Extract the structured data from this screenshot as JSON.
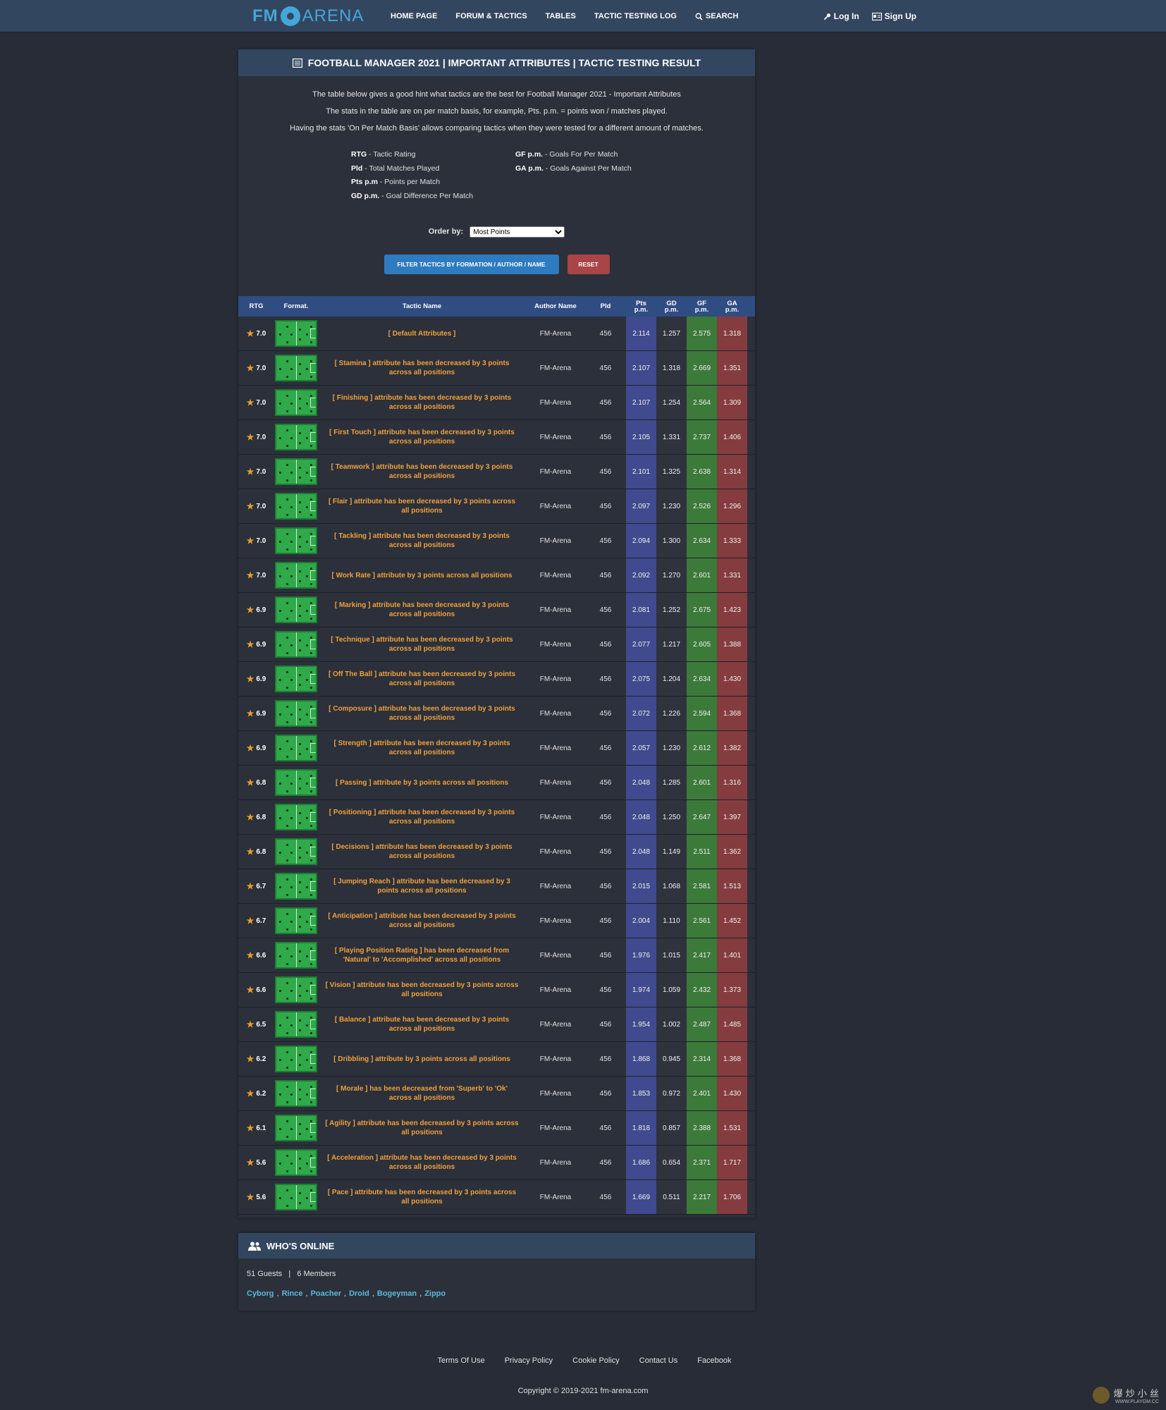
{
  "nav": {
    "logo_left": "FM",
    "logo_right": "ARENA",
    "links": [
      "HOME PAGE",
      "FORUM & TACTICS",
      "TABLES",
      "TACTIC TESTING LOG",
      "SEARCH"
    ],
    "login": "Log In",
    "signup": "Sign Up"
  },
  "card": {
    "title": "FOOTBALL MANAGER 2021 | IMPORTANT ATTRIBUTES | TACTIC TESTING RESULT",
    "intro": [
      "The table below gives a good hint what tactics are the best for Football Manager 2021 - Important Attributes",
      "The stats in the table are on per match basis, for example, Pts. p.m. = points won / matches played.",
      "Having the stats 'On Per Match Basis' allows comparing tactics when they were tested for a different amount of matches."
    ],
    "legend": {
      "rtg_k": "RTG",
      "rtg_v": " - Tactic Rating",
      "gf_k": "GF p.m.",
      "gf_v": " - Goals For Per Match",
      "pld_k": "Pld",
      "pld_v": " - Total Matches Played",
      "ga_k": "GA p.m.",
      "ga_v": " - Goals Against Per Match",
      "pts_k": "Pts p.m",
      "pts_v": " - Points per Match",
      "gd_k": "GD p.m.",
      "gd_v": " - Goal Difference Per Match"
    },
    "order_label": "Order by:",
    "order_value": "Most Points",
    "filter_button": "FILTER TACTICS BY FORMATION / AUTHOR / NAME",
    "reset_button": "RESET"
  },
  "table": {
    "headers": {
      "rtg": "RTG",
      "format": "Format.",
      "name": "Tactic Name",
      "author": "Author Name",
      "pld": "Pld",
      "pts_1": "Pts",
      "pts_2": "p.m.",
      "gd_1": "GD",
      "gd_2": "p.m.",
      "gf_1": "GF",
      "gf_2": "p.m.",
      "ga_1": "GA",
      "ga_2": "p.m."
    },
    "rows": [
      {
        "rtg": "7.0",
        "name": "[ Default Attributes ]",
        "author": "FM-Arena",
        "pld": "456",
        "pts": "2.114",
        "gd": "1.257",
        "gf": "2.575",
        "ga": "1.318"
      },
      {
        "rtg": "7.0",
        "name": "[ Stamina ] attribute has been decreased by 3 points across all positions",
        "author": "FM-Arena",
        "pld": "456",
        "pts": "2.107",
        "gd": "1.318",
        "gf": "2.669",
        "ga": "1.351"
      },
      {
        "rtg": "7.0",
        "name": "[ Finishing ] attribute has been decreased by 3 points across all positions",
        "author": "FM-Arena",
        "pld": "456",
        "pts": "2.107",
        "gd": "1.254",
        "gf": "2.564",
        "ga": "1.309"
      },
      {
        "rtg": "7.0",
        "name": "[ First Touch ] attribute has been decreased by 3 points across all positions",
        "author": "FM-Arena",
        "pld": "456",
        "pts": "2.105",
        "gd": "1.331",
        "gf": "2.737",
        "ga": "1.406"
      },
      {
        "rtg": "7.0",
        "name": "[ Teamwork ] attribute has been decreased by 3 points across all positions",
        "author": "FM-Arena",
        "pld": "456",
        "pts": "2.101",
        "gd": "1.325",
        "gf": "2.638",
        "ga": "1.314"
      },
      {
        "rtg": "7.0",
        "name": "[ Flair ] attribute has been decreased by 3 points across all positions",
        "author": "FM-Arena",
        "pld": "456",
        "pts": "2.097",
        "gd": "1.230",
        "gf": "2.526",
        "ga": "1.296"
      },
      {
        "rtg": "7.0",
        "name": "[ Tackling ] attribute has been decreased by 3 points across all positions",
        "author": "FM-Arena",
        "pld": "456",
        "pts": "2.094",
        "gd": "1.300",
        "gf": "2.634",
        "ga": "1.333"
      },
      {
        "rtg": "7.0",
        "name": "[ Work Rate ] attribute by 3 points across all positions",
        "author": "FM-Arena",
        "pld": "456",
        "pts": "2.092",
        "gd": "1.270",
        "gf": "2.601",
        "ga": "1.331"
      },
      {
        "rtg": "6.9",
        "name": "[ Marking ] attribute has been decreased by 3 points across all positions",
        "author": "FM-Arena",
        "pld": "456",
        "pts": "2.081",
        "gd": "1.252",
        "gf": "2.675",
        "ga": "1.423"
      },
      {
        "rtg": "6.9",
        "name": "[ Technique ] attribute has been decreased by 3 points across all positions",
        "author": "FM-Arena",
        "pld": "456",
        "pts": "2.077",
        "gd": "1.217",
        "gf": "2.605",
        "ga": "1.388"
      },
      {
        "rtg": "6.9",
        "name": "[ Off The Ball ] attribute has been decreased by 3 points across all positions",
        "author": "FM-Arena",
        "pld": "456",
        "pts": "2.075",
        "gd": "1.204",
        "gf": "2.634",
        "ga": "1.430"
      },
      {
        "rtg": "6.9",
        "name": "[ Composure ] attribute has been decreased by 3 points across all positions",
        "author": "FM-Arena",
        "pld": "456",
        "pts": "2.072",
        "gd": "1.226",
        "gf": "2.594",
        "ga": "1.368"
      },
      {
        "rtg": "6.9",
        "name": "[ Strength ] attribute has been decreased by 3 points across all positions",
        "author": "FM-Arena",
        "pld": "456",
        "pts": "2.057",
        "gd": "1.230",
        "gf": "2.612",
        "ga": "1.382"
      },
      {
        "rtg": "6.8",
        "name": "[ Passing ] attribute by 3 points across all positions",
        "author": "FM-Arena",
        "pld": "456",
        "pts": "2.048",
        "gd": "1.285",
        "gf": "2.601",
        "ga": "1.316"
      },
      {
        "rtg": "6.8",
        "name": "[ Positioning ] attribute has been decreased by 3 points across all positions",
        "author": "FM-Arena",
        "pld": "456",
        "pts": "2.048",
        "gd": "1.250",
        "gf": "2.647",
        "ga": "1.397"
      },
      {
        "rtg": "6.8",
        "name": "[ Decisions ] attribute has been decreased by 3 points across all positions",
        "author": "FM-Arena",
        "pld": "456",
        "pts": "2.048",
        "gd": "1.149",
        "gf": "2.511",
        "ga": "1.362"
      },
      {
        "rtg": "6.7",
        "name": "[ Jumping Reach ] attribute has been decreased by 3 points across all positions",
        "author": "FM-Arena",
        "pld": "456",
        "pts": "2.015",
        "gd": "1.068",
        "gf": "2.581",
        "ga": "1.513"
      },
      {
        "rtg": "6.7",
        "name": "[ Anticipation ] attribute has been decreased by 3 points across all positions",
        "author": "FM-Arena",
        "pld": "456",
        "pts": "2.004",
        "gd": "1.110",
        "gf": "2.561",
        "ga": "1.452"
      },
      {
        "rtg": "6.6",
        "name": "[ Playing Position Rating ] has been decreased from 'Natural' to 'Accomplished' across all positions",
        "author": "FM-Arena",
        "pld": "456",
        "pts": "1.976",
        "gd": "1.015",
        "gf": "2.417",
        "ga": "1.401"
      },
      {
        "rtg": "6.6",
        "name": "[ Vision ] attribute has been decreased by 3 points across all positions",
        "author": "FM-Arena",
        "pld": "456",
        "pts": "1.974",
        "gd": "1.059",
        "gf": "2.432",
        "ga": "1.373"
      },
      {
        "rtg": "6.5",
        "name": "[ Balance ] attribute has been decreased by 3 points across all positions",
        "author": "FM-Arena",
        "pld": "456",
        "pts": "1.954",
        "gd": "1.002",
        "gf": "2.487",
        "ga": "1.485"
      },
      {
        "rtg": "6.2",
        "name": "[ Dribbling ] attribute by 3 points across all positions",
        "author": "FM-Arena",
        "pld": "456",
        "pts": "1.868",
        "gd": "0.945",
        "gf": "2.314",
        "ga": "1.368"
      },
      {
        "rtg": "6.2",
        "name": "[ Morale ] has been decreased from 'Superb' to 'Ok' across all positions",
        "author": "FM-Arena",
        "pld": "456",
        "pts": "1.853",
        "gd": "0.972",
        "gf": "2.401",
        "ga": "1.430"
      },
      {
        "rtg": "6.1",
        "name": "[ Agility ] attribute has been decreased by 3 points across all positions",
        "author": "FM-Arena",
        "pld": "456",
        "pts": "1.818",
        "gd": "0.857",
        "gf": "2.388",
        "ga": "1.531"
      },
      {
        "rtg": "5.6",
        "name": "[ Acceleration ] attribute has been decreased by 3 points across all positions",
        "author": "FM-Arena",
        "pld": "456",
        "pts": "1.686",
        "gd": "0.654",
        "gf": "2.371",
        "ga": "1.717"
      },
      {
        "rtg": "5.6",
        "name": "[ Pace ] attribute has been decreased by 3 points across all positions",
        "author": "FM-Arena",
        "pld": "456",
        "pts": "1.669",
        "gd": "0.511",
        "gf": "2.217",
        "ga": "1.706"
      }
    ]
  },
  "online": {
    "title": "WHO'S ONLINE",
    "guests": "51 Guests",
    "separator": "|",
    "members_count": "6 Members",
    "members": [
      "Cyborg",
      "Rince",
      "Poacher",
      "Droid",
      "Bogeyman",
      "Zippo"
    ]
  },
  "footer": {
    "links": [
      "Terms Of Use",
      "Privacy Policy",
      "Cookie Policy",
      "Contact Us",
      "Facebook"
    ],
    "copyright": "Copyright © 2019-2021 fm-arena.com",
    "watermark": "爆 炒 小 丝",
    "watermark_sub": "WWW.PLAYGM.CC"
  },
  "icons": {
    "search": "search-icon",
    "login": "key-icon",
    "signup": "signup-card-icon",
    "title": "list-icon",
    "star": "star-icon",
    "users": "users-icon"
  },
  "colors": {
    "page_bg": "#272c36",
    "nav_bg": "#33465f",
    "accent_blue": "#2f7bbf",
    "reset_red": "#a94447",
    "tactic_orange": "#f0a03c",
    "pts_col": "#3f4b8e",
    "gf_col": "#3c7a39",
    "ga_col": "#853c3f"
  }
}
